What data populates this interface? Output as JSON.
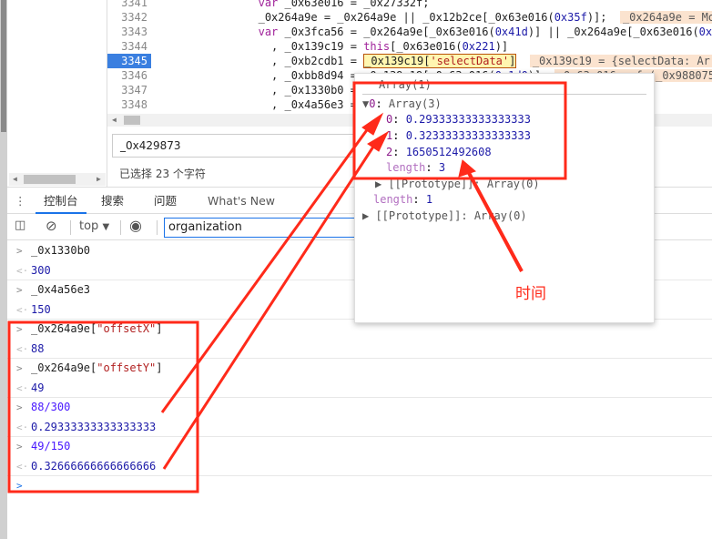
{
  "code": {
    "lines": [
      {
        "n": "3341",
        "html": "                <span class=\"kw\">var</span> _0x63e016 = _0x27332f;"
      },
      {
        "n": "3342",
        "html": "                _0x264a9e = _0x264a9e || _0x12b2ce[_0x63e016(<span class=\"num\">0x35f</span>)];  <span class=\"inl\">_0x264a9e = Mo</span>"
      },
      {
        "n": "3343",
        "html": "                <span class=\"kw\">var</span> _0x3fca56 = _0x264a9e[_0x63e016(<span class=\"num\">0x41d</span>)] || _0x264a9e[_0x63e016(<span class=\"num\">0x</span>"
      },
      {
        "n": "3344",
        "html": "                  , _0x139c19 = <span class=\"kw\">this</span>[_0x63e016(<span class=\"num\">0x221</span>)]"
      },
      {
        "n": "3345",
        "html": "                  , _0xb2cdb1 = <span id=\"hl\">_0x139c19[<span class=\"str\">'selectData'</span>]</span>  <span class=\"inl\">_0x139c19 = {selectData: Arr</span>",
        "active": true
      },
      {
        "n": "3346",
        "html": "                  , _0xbb8d94 = _0x139c19[_0x63e016(<span class=\"num\">0x1d0</span>)]  <span class=\"inl\">_0x63e016 = f (_0x988075</span>"
      },
      {
        "n": "3347",
        "html": "                  , _0x1330b0 = "
      },
      {
        "n": "3348",
        "html": "                  , _0x4a56e3 = "
      }
    ]
  },
  "search": {
    "value": "_0x429873"
  },
  "selection_info": "已选择 23 个字符",
  "tabs": [
    "控制台",
    "搜索",
    "问题",
    "What's New"
  ],
  "toolbar": {
    "context": "top",
    "filter": "organization"
  },
  "console": [
    {
      "type": "in",
      "text": "_0x1330b0"
    },
    {
      "type": "out",
      "text": "300"
    },
    {
      "type": "in",
      "text": "_0x4a56e3"
    },
    {
      "type": "out",
      "text": "150"
    },
    {
      "type": "in",
      "text": "_0x264a9e[\"offsetX\"]"
    },
    {
      "type": "out",
      "text": "88"
    },
    {
      "type": "in",
      "text": "_0x264a9e[\"offsetY\"]"
    },
    {
      "type": "out",
      "text": "49"
    },
    {
      "type": "expr",
      "text": "88/300"
    },
    {
      "type": "out",
      "text": "0.29333333333333333"
    },
    {
      "type": "expr",
      "text": "49/150"
    },
    {
      "type": "out",
      "text": "0.32666666666666666"
    }
  ],
  "popup": {
    "title": "Array(1)",
    "item0": "Array(3)",
    "v0": "0.29333333333333333",
    "v1": "0.32333333333333333",
    "v2": "1650512492608",
    "inner_length": "3",
    "proto": "Array(0)",
    "outer_length": "1"
  },
  "annotation": {
    "label": "时间",
    "color": "#ff2a1a"
  }
}
